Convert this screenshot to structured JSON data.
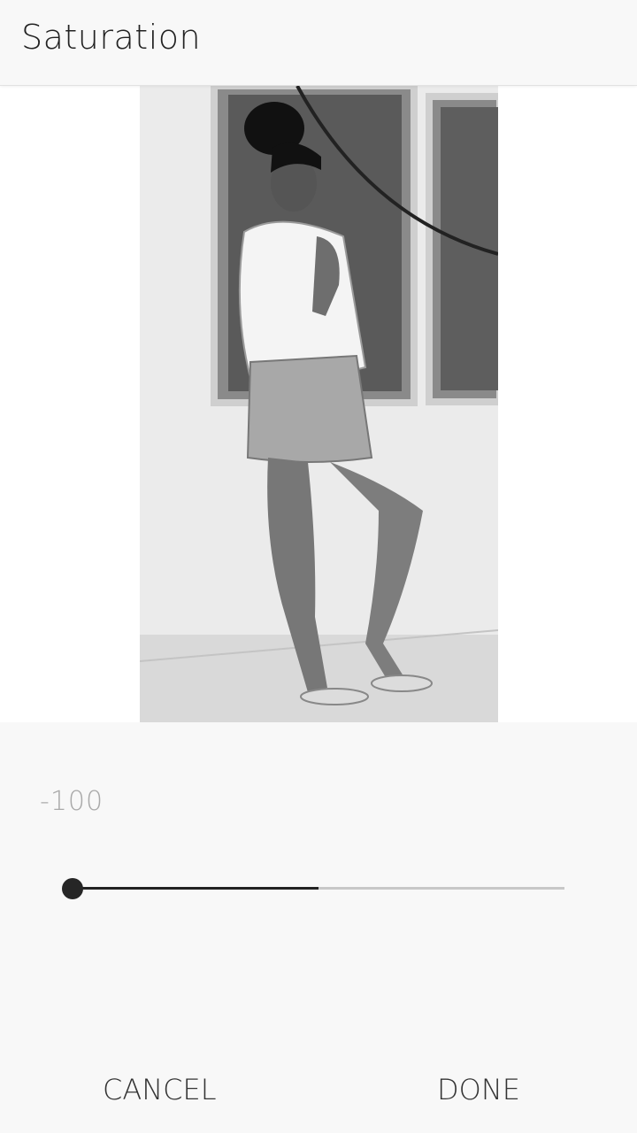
{
  "header": {
    "title": "Saturation"
  },
  "adjustment": {
    "value_label": "-100",
    "slider": {
      "min": -100,
      "max": 100,
      "value": -100
    }
  },
  "footer": {
    "cancel_label": "CANCEL",
    "done_label": "DONE"
  },
  "colors": {
    "background": "#f9f9f9",
    "text": "#222222",
    "muted": "#a9a9a9",
    "track": "#c8c8c8",
    "thumb": "#262626"
  }
}
